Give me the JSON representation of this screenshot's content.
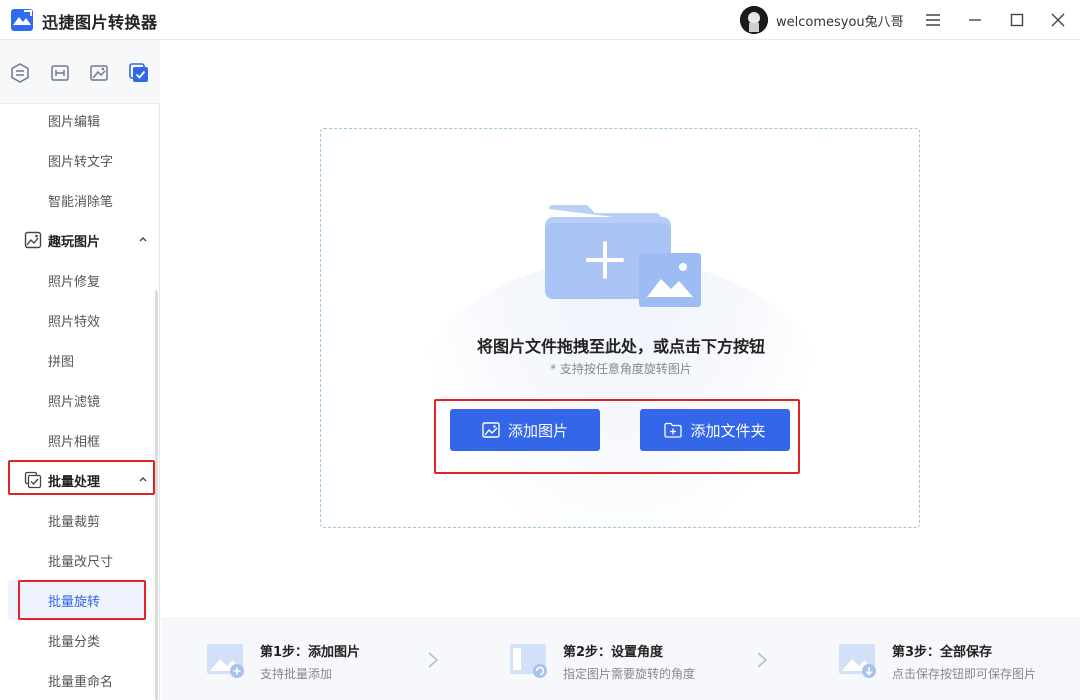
{
  "app": {
    "title": "迅捷图片转换器"
  },
  "user": {
    "name": "welcomesyou兔八哥"
  },
  "sidebar": {
    "items_top": [
      "图片编辑",
      "图片转文字",
      "智能消除笔"
    ],
    "group_fun": "趣玩图片",
    "items_fun": [
      "照片修复",
      "照片特效",
      "拼图",
      "照片滤镜",
      "照片相框"
    ],
    "group_batch": "批量处理",
    "items_batch": [
      "批量裁剪",
      "批量改尺寸",
      "批量旋转",
      "批量分类",
      "批量重命名"
    ]
  },
  "dropzone": {
    "title": "将图片文件拖拽至此处，或点击下方按钮",
    "subtitle": "* 支持按任意角度旋转图片",
    "add_image": "添加图片",
    "add_folder": "添加文件夹"
  },
  "steps": [
    {
      "title": "第1步：添加图片",
      "desc": "支持批量添加"
    },
    {
      "title": "第2步：设置角度",
      "desc": "指定图片需要旋转的角度"
    },
    {
      "title": "第3步：全部保存",
      "desc": "点击保存按钮即可保存图片"
    }
  ],
  "colors": {
    "accent": "#3366e8",
    "highlight": "#e02424"
  }
}
